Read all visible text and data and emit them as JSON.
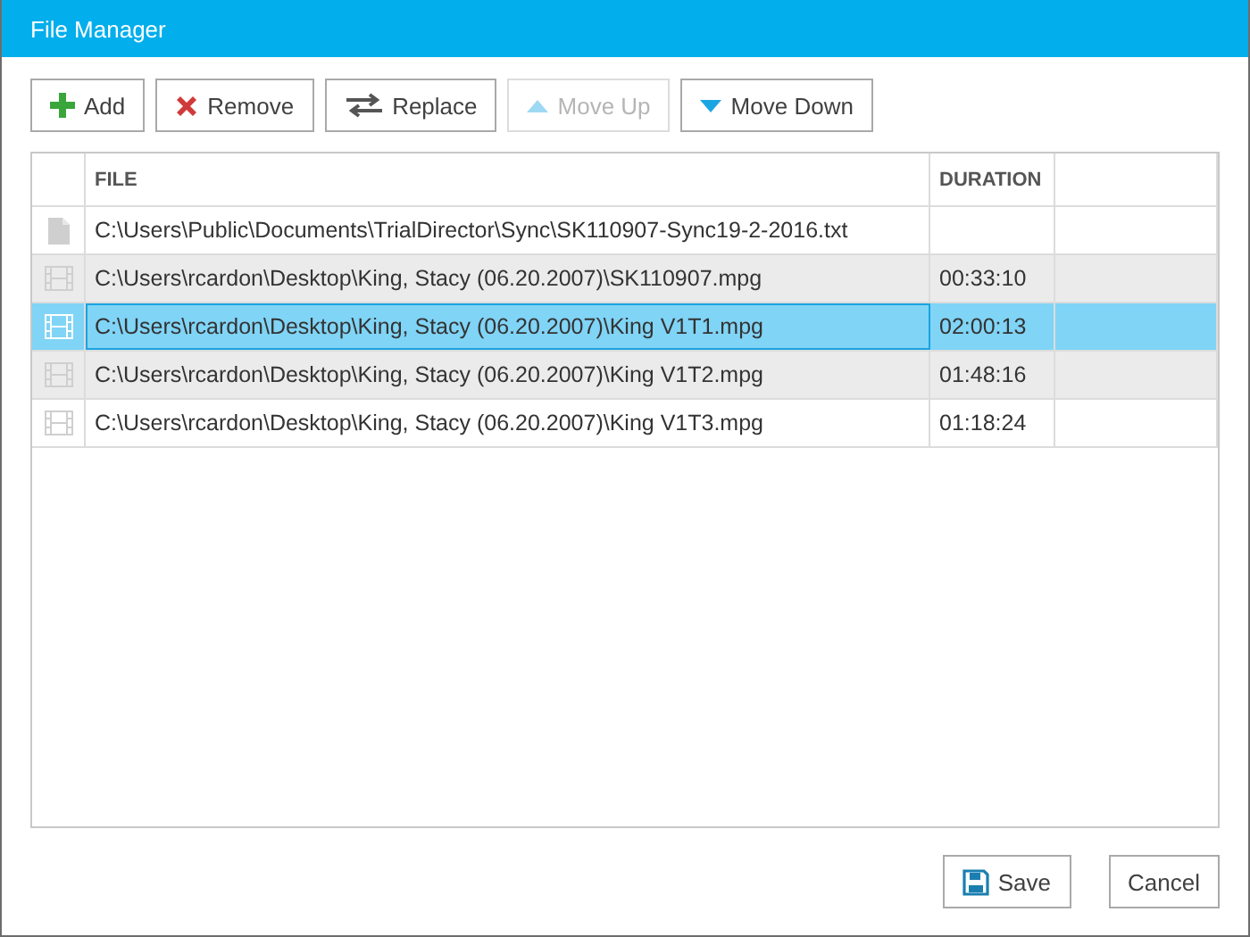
{
  "window": {
    "title": "File Manager"
  },
  "toolbar": [
    {
      "label": "Add",
      "kind": "add",
      "disabled": false
    },
    {
      "label": "Remove",
      "kind": "remove",
      "disabled": false
    },
    {
      "label": "Replace",
      "kind": "replace",
      "disabled": false
    },
    {
      "label": "Move Up",
      "kind": "up",
      "disabled": true
    },
    {
      "label": "Move Down",
      "kind": "down",
      "disabled": false
    }
  ],
  "table": {
    "columns": [
      "FILE",
      "DURATION"
    ],
    "rows": [
      {
        "kind": "document",
        "file": "C:\\Users\\Public\\Documents\\TrialDirector\\Sync\\SK110907-Sync19-2-2016.txt",
        "selected": false
      },
      {
        "kind": "video",
        "file": "C:\\Users\\rcardon\\Desktop\\King, Stacy (06.20.2007)\\SK110907.mpg",
        "duration": "00:33:10",
        "selected": false
      },
      {
        "kind": "video",
        "file": "C:\\Users\\rcardon\\Desktop\\King, Stacy (06.20.2007)\\King V1T1.mpg",
        "duration": "02:00:13",
        "selected": true
      },
      {
        "kind": "video",
        "file": "C:\\Users\\rcardon\\Desktop\\King, Stacy (06.20.2007)\\King V1T2.mpg",
        "duration": "01:48:16",
        "selected": false
      },
      {
        "kind": "video",
        "file": "C:\\Users\\rcardon\\Desktop\\King, Stacy (06.20.2007)\\King V1T3.mpg",
        "duration": "01:18:24",
        "selected": false
      }
    ]
  },
  "footer": [
    {
      "label": "Save",
      "kind": "save"
    },
    {
      "label": "Cancel",
      "kind": "cancel"
    }
  ]
}
